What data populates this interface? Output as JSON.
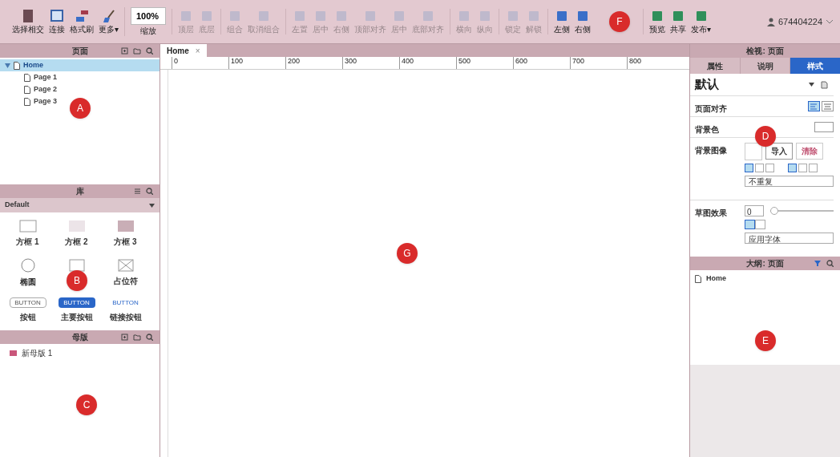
{
  "toolbar": {
    "groups": [
      [
        {
          "label": "选择相交",
          "disabled": false
        },
        {
          "label": "连接",
          "disabled": false
        },
        {
          "label": "格式刷",
          "disabled": false
        },
        {
          "label": "更多▾",
          "disabled": false
        }
      ],
      [
        {
          "label": "缩放",
          "zoom": "100%",
          "disabled": false
        }
      ],
      [
        {
          "label": "顶层",
          "disabled": true
        },
        {
          "label": "底层",
          "disabled": true
        }
      ],
      [
        {
          "label": "组合",
          "disabled": true
        },
        {
          "label": "取消组合",
          "disabled": true
        }
      ],
      [
        {
          "label": "左置",
          "disabled": true
        },
        {
          "label": "居中",
          "disabled": true
        },
        {
          "label": "右侧",
          "disabled": true
        },
        {
          "label": "顶部对齐",
          "disabled": true
        },
        {
          "label": "居中",
          "disabled": true
        },
        {
          "label": "底部对齐",
          "disabled": true
        }
      ],
      [
        {
          "label": "横向",
          "disabled": true
        },
        {
          "label": "纵向",
          "disabled": true
        }
      ],
      [
        {
          "label": "锁定",
          "disabled": true
        },
        {
          "label": "解锁",
          "disabled": true
        }
      ],
      [
        {
          "label": "左侧",
          "disabled": false
        },
        {
          "label": "右侧",
          "disabled": false
        }
      ],
      [
        {
          "label": "预览",
          "disabled": false
        },
        {
          "label": "共享",
          "disabled": false
        },
        {
          "label": "发布▾",
          "disabled": false
        }
      ]
    ],
    "user": "674404224"
  },
  "pages_panel": {
    "title": "页面",
    "tree": [
      {
        "label": "Home",
        "selected": true,
        "expanded": true,
        "children": [
          {
            "label": "Page 1",
            "selected": false
          },
          {
            "label": "Page 2",
            "selected": false
          },
          {
            "label": "Page 3",
            "selected": false
          }
        ]
      }
    ]
  },
  "library_panel": {
    "title": "库",
    "library": "Default",
    "widgets": [
      {
        "kind": "box1",
        "label": "方框 1"
      },
      {
        "kind": "box2",
        "label": "方框 2"
      },
      {
        "kind": "box3",
        "label": "方框 3"
      },
      {
        "kind": "ellipse",
        "label": "椭圆"
      },
      {
        "kind": "image"
      },
      {
        "kind": "placeholder",
        "label": "占位符"
      },
      {
        "kind": "button",
        "label": "按钮",
        "preview": "BUTTON"
      },
      {
        "kind": "primary-button",
        "label": "主要按钮",
        "preview": "BUTTON"
      },
      {
        "kind": "link-button",
        "label": "链接按钮",
        "preview": "BUTTON"
      }
    ]
  },
  "masters_panel": {
    "title": "母版",
    "items": [
      "新母版 1"
    ]
  },
  "canvas": {
    "tabs": [
      {
        "label": "Home",
        "close": "×",
        "selected": true
      }
    ],
    "ruler": [
      "0",
      "100",
      "200",
      "300",
      "400",
      "500",
      "600",
      "700",
      "800"
    ]
  },
  "inspector": {
    "title": "检视: 页面",
    "tabs": [
      {
        "label": "属性",
        "selected": false
      },
      {
        "label": "说明",
        "selected": false
      },
      {
        "label": "样式",
        "selected": true
      }
    ],
    "style_name": "默认",
    "page_align_label": "页面对齐",
    "bg_color_label": "背景色",
    "bg_image_label": "背景图像",
    "import": "导入",
    "clear": "清除",
    "repeat": "不重复",
    "sketch_label": "草图效果",
    "sketch_value": "0",
    "sketch_slider": {
      "level": 0
    },
    "font": "应用字体"
  },
  "outline_panel": {
    "title": "大纲: 页面",
    "items": [
      "Home"
    ]
  },
  "callouts": [
    {
      "letter": "A"
    },
    {
      "letter": "B"
    },
    {
      "letter": "C"
    },
    {
      "letter": "D"
    },
    {
      "letter": "E"
    },
    {
      "letter": "F"
    },
    {
      "letter": "G"
    }
  ]
}
